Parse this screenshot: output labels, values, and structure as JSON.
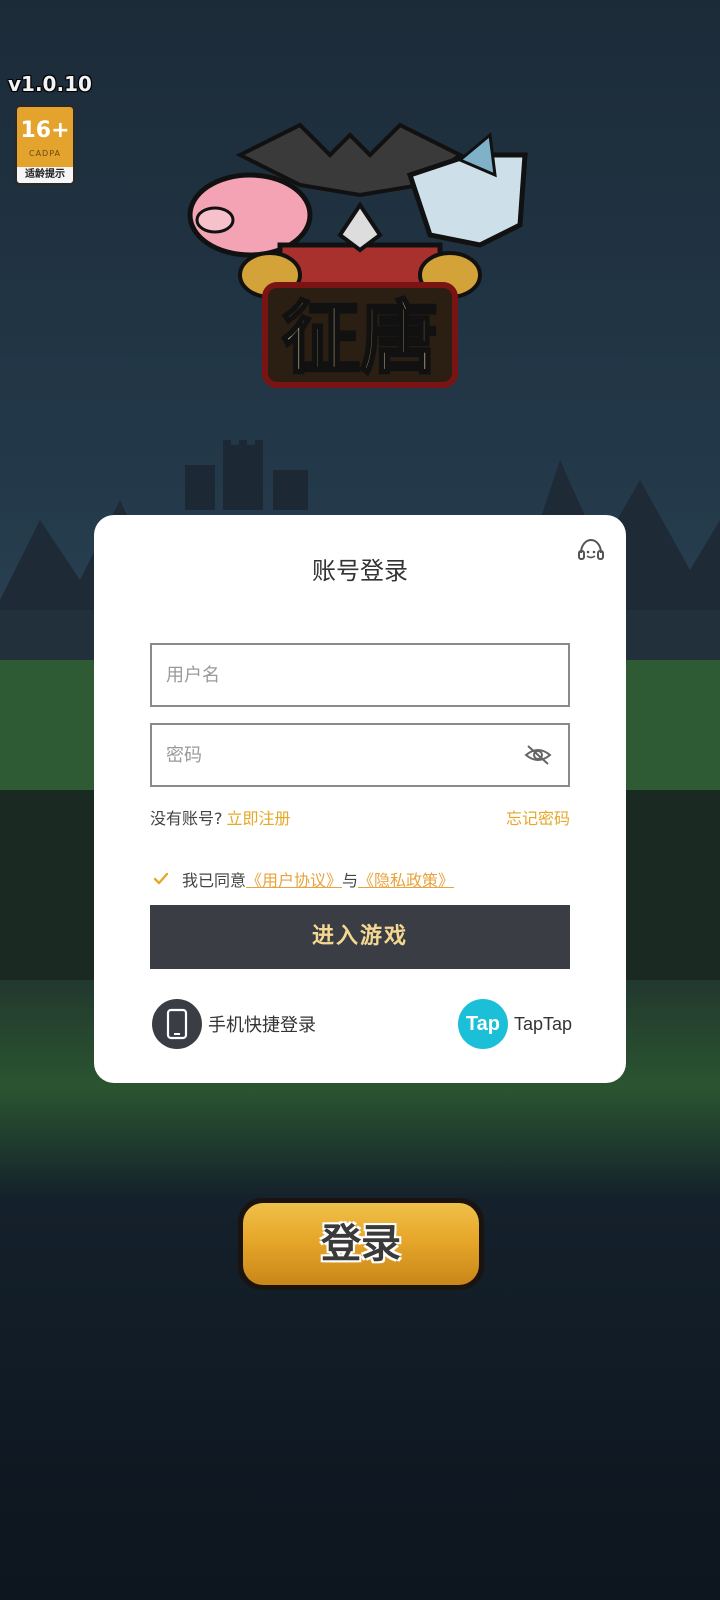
{
  "app": {
    "version": "v1.0.10",
    "age_rating": {
      "age": "16+",
      "org": "CADPA",
      "tip": "适龄提示"
    },
    "logo_title": "征唐"
  },
  "login_dialog": {
    "title": "账号登录",
    "username_placeholder": "用户名",
    "password_placeholder": "密码",
    "no_account_text": "没有账号?",
    "register_link": "立即注册",
    "forgot_link": "忘记密码",
    "agree_text": "我已同意",
    "user_agreement": "《用户协议》",
    "and_text": "与",
    "privacy_policy": "《隐私政策》",
    "agreement_checked": true,
    "enter_button": "进入游戏",
    "phone_login": "手机快捷登录",
    "taptap_icon_text": "Tap",
    "taptap_label": "TapTap"
  },
  "main": {
    "login_button": "登录"
  },
  "icons": [
    "support-icon",
    "eye-off-icon",
    "check-icon",
    "phone-icon",
    "taptap-icon"
  ],
  "colors": {
    "accent": "#e4a928",
    "button_dark": "#3a3d44",
    "button_text": "#f4d892",
    "taptap": "#1bc0d8"
  }
}
